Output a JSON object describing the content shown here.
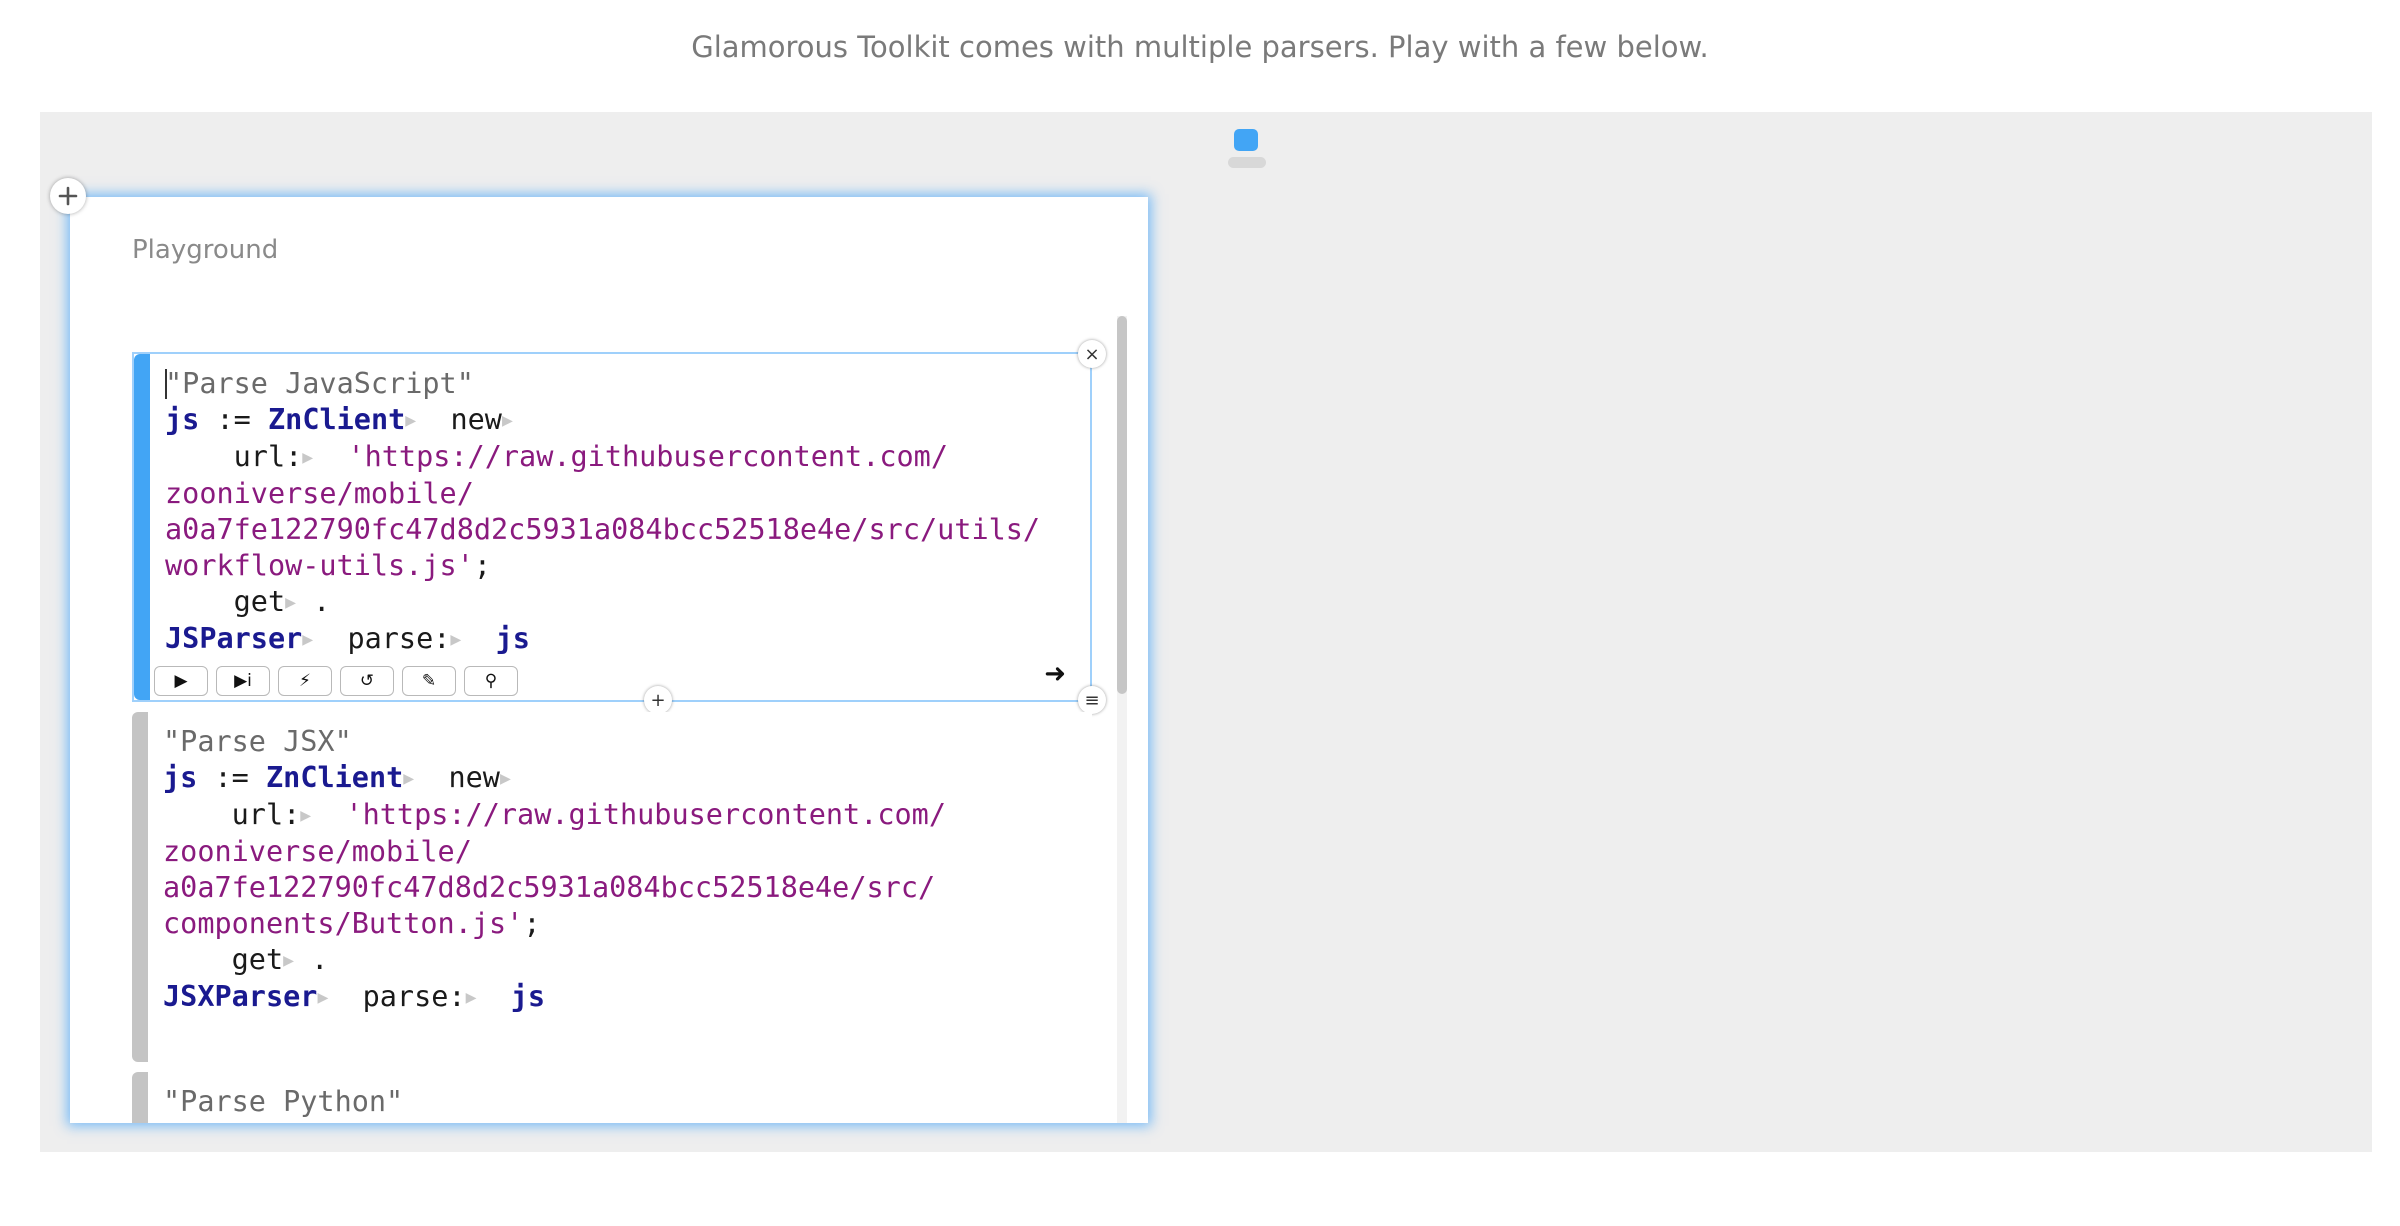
{
  "intro": {
    "text": "Glamorous Toolkit comes with multiple parsers. Play with a few below."
  },
  "pane": {
    "title": "Playground"
  },
  "snippets": {
    "js": {
      "comment": "\"Parse JavaScript\"",
      "var": "js",
      "assign": ":=",
      "client": "ZnClient",
      "new": "new",
      "url_kw": "url:",
      "url_1": "'https://raw.githubusercontent.com/",
      "url_2": "zooniverse/mobile/",
      "url_3": "a0a7fe122790fc47d8d2c5931a084bcc52518e4e/src/utils/",
      "url_4": "workflow-utils.js'",
      "semi": ";",
      "get": "get",
      "dot": ".",
      "parser": "JSParser",
      "parse_kw": "parse:",
      "arg": "js"
    },
    "jsx": {
      "comment": "\"Parse JSX\"",
      "var": "js",
      "assign": ":=",
      "client": "ZnClient",
      "new": "new",
      "url_kw": "url:",
      "url_1": "'https://raw.githubusercontent.com/",
      "url_2": "zooniverse/mobile/",
      "url_3": "a0a7fe122790fc47d8d2c5931a084bcc52518e4e/src/",
      "url_4": "components/Button.js'",
      "semi": ";",
      "get": "get",
      "dot": ".",
      "parser": "JSXParser",
      "parse_kw": "parse:",
      "arg": "js"
    },
    "python": {
      "comment": "\"Parse Python\""
    }
  },
  "toolbar": {
    "buttons": [
      {
        "icon": "play-icon",
        "glyph": "▶"
      },
      {
        "icon": "play-inspect-icon",
        "glyph": "▶i"
      },
      {
        "icon": "lightning-icon",
        "glyph": "⚡"
      },
      {
        "icon": "debug-icon",
        "glyph": "↺"
      },
      {
        "icon": "pencil-icon",
        "glyph": "✎"
      },
      {
        "icon": "search-icon",
        "glyph": "⚲"
      }
    ],
    "arrow_glyph": "➜"
  },
  "glyphs": {
    "plus": "+",
    "close": "×",
    "menu": "≡",
    "triangle": "▶"
  },
  "colors": {
    "accent": "#42a5f5",
    "string": "#8a1a7e",
    "identifier": "#1a1a90",
    "canvas": "#eeeeee"
  }
}
